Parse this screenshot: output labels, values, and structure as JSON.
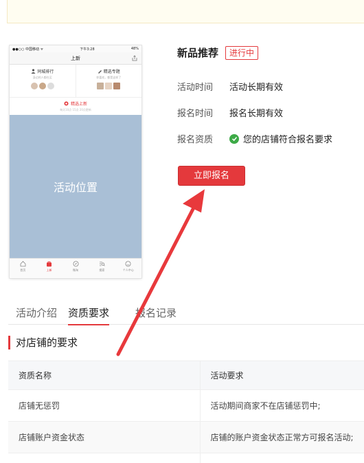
{
  "phone": {
    "status_left": "●●○○ 中国移动 ᯤ",
    "status_time": "下午3:28",
    "status_right": "48%",
    "nav_title": "上新",
    "card_left_title": "同城排行",
    "card_left_sub": "身边的人都在买",
    "card_right_title": "精选专题",
    "card_right_sub": "你喜欢，都是这样了",
    "featured_title": "精选上新",
    "featured_sub": "每天10点 15点 20点更新",
    "activity_label": "活动位置",
    "tabbar": [
      "首页",
      "上新",
      "微淘",
      "搜索",
      "个人中心"
    ]
  },
  "product": {
    "title": "新品推荐",
    "status": "进行中",
    "rows": [
      {
        "label": "活动时间",
        "value": "活动长期有效"
      },
      {
        "label": "报名时间",
        "value": "报名长期有效"
      },
      {
        "label": "报名资质",
        "value": "您的店铺符合报名要求"
      }
    ],
    "signup_label": "立即报名"
  },
  "tabs": [
    "活动介绍",
    "资质要求",
    "报名记录"
  ],
  "active_tab": "资质要求",
  "section_title": "对店铺的要求",
  "table": {
    "headers": [
      "资质名称",
      "活动要求"
    ],
    "rows": [
      [
        "店铺无惩罚",
        "活动期间商家不在店铺惩罚中;"
      ],
      [
        "店铺账户资金状态",
        "店铺的账户资金状态正常方可报名活动;"
      ]
    ]
  },
  "colors": {
    "accent": "#e4393c",
    "check": "#3daa47",
    "placeholder": "#a9bfd6"
  },
  "icons": [
    "user-icon",
    "edit-icon",
    "share-icon",
    "flame-icon",
    "check-icon",
    "home-icon",
    "bag-icon",
    "compass-icon",
    "search-icon",
    "smile-icon",
    "arrow-annotation"
  ]
}
